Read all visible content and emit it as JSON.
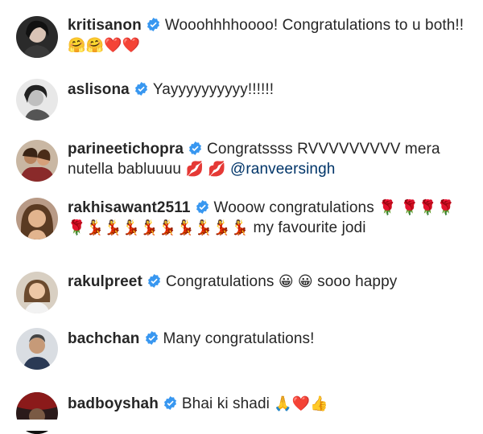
{
  "comments": [
    {
      "username": "kritisanon",
      "text": "Wooohhhhoooo! Congratulations to u both!!",
      "emojis": "🤗🤗❤️❤️",
      "avatar": "profile-photo"
    },
    {
      "username": "aslisona",
      "text": "Yayyyyyyyyyy!!!!!!",
      "avatar": "profile-photo"
    },
    {
      "username": "parineetichopra",
      "text": "Congratssss RVVVVVVVVV mera nutella babluuuu",
      "emojis": "💋 💋",
      "mention": "@ranveersingh",
      "avatar": "profile-photo"
    },
    {
      "username": "rakhisawant2511",
      "text": "Wooow congratulations",
      "emojis": "🌹 🌹🌹🌹🌹💃💃💃💃💃💃💃💃💃",
      "text_after": "my favourite jodi",
      "avatar": "profile-photo"
    },
    {
      "username": "rakulpreet",
      "text": "Congratulations",
      "emojis": "😀 😀",
      "text_after": "sooo happy",
      "avatar": "profile-photo"
    },
    {
      "username": "bachchan",
      "text": "Many congratulations!",
      "avatar": "profile-photo"
    },
    {
      "username": "badboyshah",
      "text": "Bhai ki shadi",
      "emojis": "🙏❤️👍",
      "avatar": "profile-photo"
    }
  ],
  "icons": {
    "verified": "verified-badge-icon"
  },
  "colors": {
    "verified_blue": "#3897f0",
    "text": "#262626",
    "mention": "#003569"
  }
}
